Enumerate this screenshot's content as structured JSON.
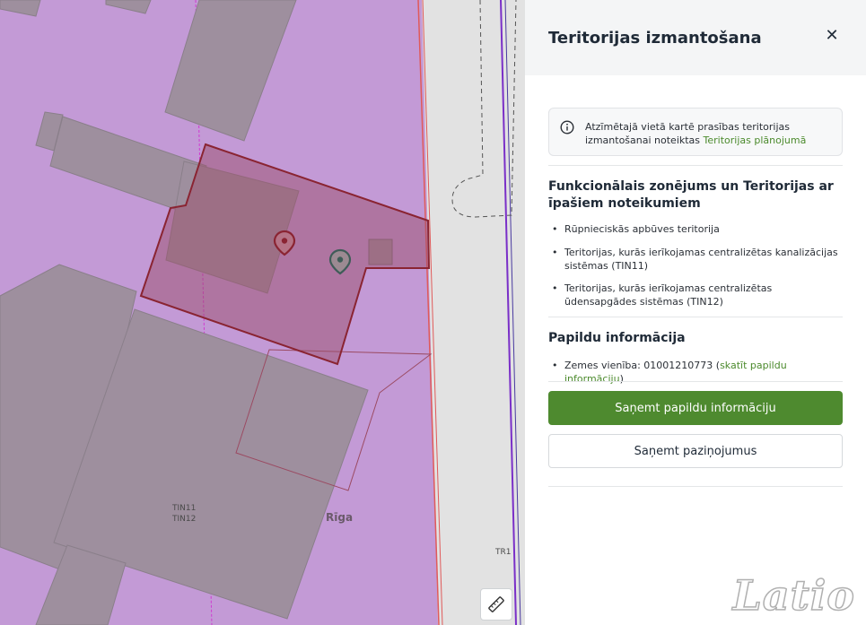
{
  "map": {
    "labels": {
      "tin11": "TIN11",
      "tin12": "TIN12",
      "city": "Rīga",
      "tr1": "TR1"
    },
    "icons": {
      "selected_marker": "map-pin-icon",
      "building_marker": "map-pin-icon",
      "measure": "ruler-icon"
    },
    "colors": {
      "zone_fill": "#c39ad6",
      "road": "#e2e2e2",
      "parcel_highlight": "#9b4f6b",
      "pin_red": "#8a2432",
      "pin_green": "#3f5c58"
    }
  },
  "panel": {
    "title": "Teritorijas izmantošana",
    "close_icon": "close-icon",
    "info": {
      "icon": "info-icon",
      "text": "Atzīmētajā vietā kartē prasības teritorijas izmantošanai noteiktas ",
      "link": "Teritorijas plānojumā"
    },
    "zoning": {
      "title": "Funkcionālais zonējums un Teritorijas ar īpašiem noteikumiem",
      "items": [
        "Rūpnieciskās apbūves teritorija",
        "Teritorijas, kurās ierīkojamas centralizētas kanalizācijas sistēmas (TIN11)",
        "Teritorijas, kurās ierīkojamas centralizētas ūdensapgādes sistēmas (TIN12)"
      ]
    },
    "additional": {
      "title": "Papildu informācija",
      "parcel_prefix": "Zemes vienība: 01001210773 (",
      "parcel_link": "skatīt papildu informāciju",
      "parcel_suffix": ")"
    },
    "buttons": {
      "primary": "Saņemt papildu informāciju",
      "secondary": "Saņemt paziņojumus"
    },
    "accent_color": "#4e8a2f"
  },
  "branding": {
    "logo": "Latio"
  }
}
